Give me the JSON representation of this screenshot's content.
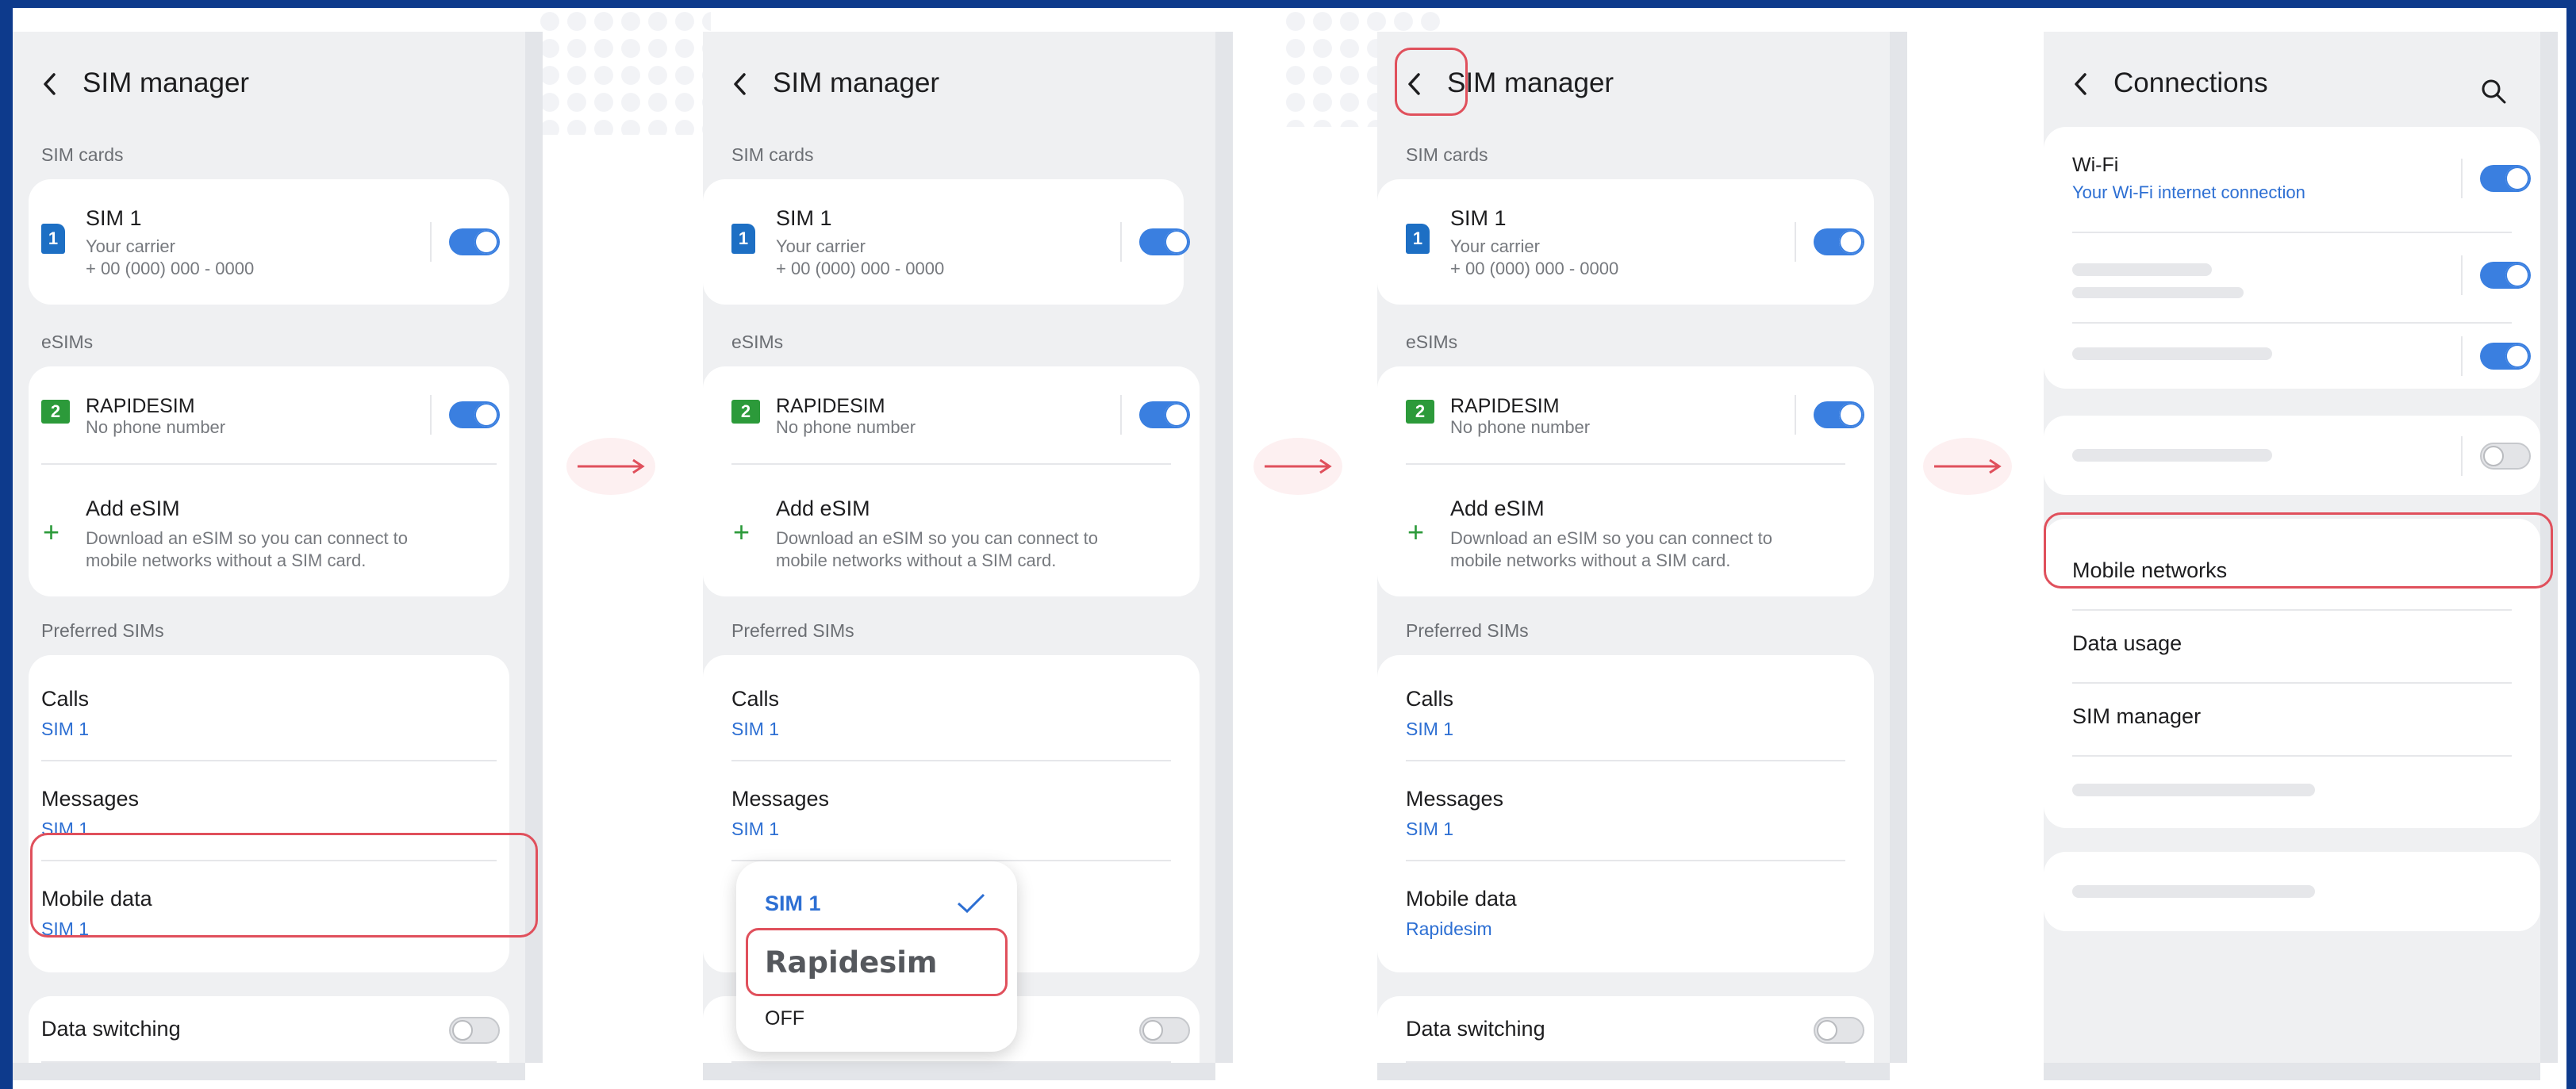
{
  "panel1": {
    "title": "SIM manager",
    "section_sim_cards": "SIM cards",
    "sim1": {
      "icon_label": "1",
      "name": "SIM 1",
      "carrier": "Your carrier",
      "number": "+ 00 (000) 000 - 0000"
    },
    "section_esims": "eSIMs",
    "esim": {
      "icon_label": "2",
      "name": "RAPIDESIM",
      "sub": "No phone number"
    },
    "add_esim": {
      "title": "Add eSIM",
      "line1": "Download an eSIM so you can connect to",
      "line2": "mobile networks without a SIM card."
    },
    "section_preferred": "Preferred SIMs",
    "calls": {
      "label": "Calls",
      "value": "SIM 1"
    },
    "messages": {
      "label": "Messages",
      "value": "SIM 1"
    },
    "mobile_data": {
      "label": "Mobile data",
      "value": "SIM 1"
    },
    "data_switching": "Data switching"
  },
  "panel2": {
    "title": "SIM manager",
    "section_sim_cards": "SIM cards",
    "sim1": {
      "icon_label": "1",
      "name": "SIM 1",
      "carrier": "Your carrier",
      "number": "+ 00 (000) 000 - 0000"
    },
    "section_esims": "eSIMs",
    "esim": {
      "icon_label": "2",
      "name": "RAPIDESIM",
      "sub": "No phone number"
    },
    "add_esim": {
      "title": "Add eSIM",
      "line1": "Download an eSIM so you can connect to",
      "line2": "mobile networks without a SIM card."
    },
    "section_preferred": "Preferred SIMs",
    "calls": {
      "label": "Calls",
      "value": "SIM 1"
    },
    "messages": {
      "label": "Messages",
      "value": "SIM 1"
    },
    "popup": {
      "option1": "SIM 1",
      "option2": "Rapidesim",
      "option3": "OFF"
    }
  },
  "panel3": {
    "title": "SIM manager",
    "section_sim_cards": "SIM cards",
    "sim1": {
      "icon_label": "1",
      "name": "SIM 1",
      "carrier": "Your carrier",
      "number": "+ 00 (000) 000 - 0000"
    },
    "section_esims": "eSIMs",
    "esim": {
      "icon_label": "2",
      "name": "RAPIDESIM",
      "sub": "No phone number"
    },
    "add_esim": {
      "title": "Add eSIM",
      "line1": "Download an eSIM so you can connect to",
      "line2": "mobile networks without a SIM card."
    },
    "section_preferred": "Preferred SIMs",
    "calls": {
      "label": "Calls",
      "value": "SIM 1"
    },
    "messages": {
      "label": "Messages",
      "value": "SIM 1"
    },
    "mobile_data": {
      "label": "Mobile data",
      "value": "Rapidesim"
    },
    "data_switching": "Data switching"
  },
  "panel4": {
    "title": "Connections",
    "wifi": {
      "label": "Wi-Fi",
      "sub": "Your Wi-Fi internet connection"
    },
    "mobile_networks": "Mobile networks",
    "data_usage": "Data usage",
    "sim_manager": "SIM manager"
  },
  "colors": {
    "accent_blue": "#3a7fe0",
    "highlight_red": "#e0505c",
    "background_navy": "#0d3a8c",
    "esim_green": "#2c9a3a"
  }
}
